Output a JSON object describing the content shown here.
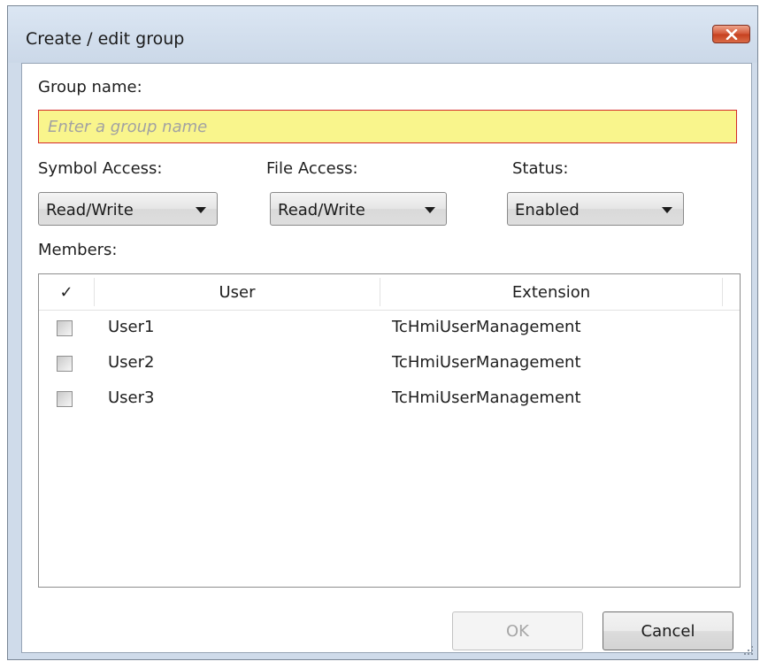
{
  "dialog": {
    "title": "Create / edit group",
    "close_icon": "close-x-icon",
    "accent_close": "#c6401f"
  },
  "group_name": {
    "label": "Group name:",
    "value": "",
    "placeholder": "Enter a group name",
    "validation_state": "invalid",
    "field_color": "#f9f58c",
    "border_color": "#d42a2a"
  },
  "symbol_access": {
    "label": "Symbol Access:",
    "value": "Read/Write"
  },
  "file_access": {
    "label": "File Access:",
    "value": "Read/Write"
  },
  "status": {
    "label": "Status:",
    "value": "Enabled"
  },
  "members": {
    "label": "Members:",
    "columns": {
      "check": "✓",
      "user": "User",
      "extension": "Extension"
    },
    "rows": [
      {
        "checked": false,
        "user": "User1",
        "extension": "TcHmiUserManagement"
      },
      {
        "checked": false,
        "user": "User2",
        "extension": "TcHmiUserManagement"
      },
      {
        "checked": false,
        "user": "User3",
        "extension": "TcHmiUserManagement"
      }
    ]
  },
  "buttons": {
    "ok": {
      "label": "OK",
      "enabled": false
    },
    "cancel": {
      "label": "Cancel",
      "enabled": true
    }
  }
}
